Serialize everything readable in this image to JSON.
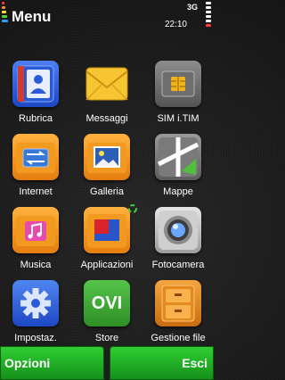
{
  "status": {
    "title": "Menu",
    "time": "22:10",
    "network": "3G",
    "signal_icon": "signal-strength-icon",
    "battery_icon": "battery-level-icon"
  },
  "apps": [
    {
      "label": "Rubrica",
      "icon": "contacts-icon"
    },
    {
      "label": "Messaggi",
      "icon": "envelope-icon"
    },
    {
      "label": "SIM i.TIM",
      "icon": "sim-card-icon"
    },
    {
      "label": "Internet",
      "icon": "internet-folder-icon"
    },
    {
      "label": "Galleria",
      "icon": "gallery-icon"
    },
    {
      "label": "Mappe",
      "icon": "maps-icon"
    },
    {
      "label": "Musica",
      "icon": "music-folder-icon"
    },
    {
      "label": "Applicazioni",
      "icon": "applications-icon"
    },
    {
      "label": "Fotocamera",
      "icon": "camera-icon"
    },
    {
      "label": "Impostaz.",
      "icon": "gear-icon"
    },
    {
      "label": "Store",
      "icon": "ovi-store-icon"
    },
    {
      "label": "Gestione file",
      "icon": "file-cabinet-icon"
    }
  ],
  "store_text": "OVI",
  "softkeys": {
    "left": "Opzioni",
    "right": "Esci"
  },
  "colors": {
    "softkey_green": "#22b427",
    "background": "#1c1c1c",
    "accent_orange": "#f29a1f",
    "accent_blue": "#2a5bd6"
  }
}
